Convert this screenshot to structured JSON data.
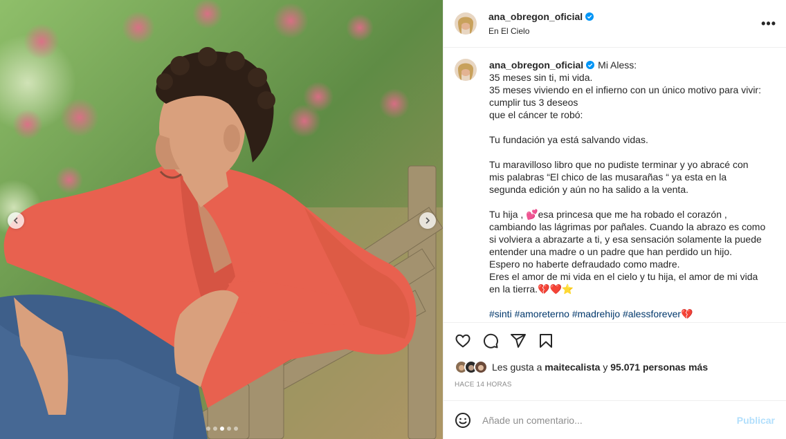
{
  "header": {
    "username": "ana_obregon_oficial",
    "location": "En El Cielo",
    "more_label": "•••"
  },
  "caption": {
    "username": "ana_obregon_oficial",
    "lines": [
      "Mi Aless:",
      "35 meses sin ti, mi vida.",
      "35 meses viviendo en el infierno con un único motivo para vivir: cumplir tus 3 deseos",
      "que el cáncer te robó:",
      "",
      "Tu fundación ya está salvando vidas.",
      "",
      "Tu maravilloso libro que no pudiste terminar y yo abracé con mis palabras “El chico de las musarañas “ ya esta en la segunda edición y aún no ha salido a la venta.",
      "",
      "Tu hija , 💕esa princesa que me ha robado el corazón , cambiando las lágrimas por pañales. Cuando la abrazo es como si volviera a abrazarte a ti, y esa sensación solamente la puede entender una madre o un padre que han perdido un hijo.",
      "Espero no haberte defraudado como madre.",
      "Eres el amor de mi vida en el cielo y tu hija, el amor de mi vida en la tierra.💔❤️⭐️",
      ""
    ],
    "hashtags": "#sinti #amoreterno #madrehijo #alessforever💔"
  },
  "likes": {
    "prefix": "Les gusta a ",
    "user": "maitecalista",
    "middle": " y ",
    "count": "95.071 personas más"
  },
  "time_ago": "HACE 14 HORAS",
  "comment_box": {
    "placeholder": "Añade un comentario...",
    "publish_label": "Publicar"
  },
  "carousel": {
    "total": 5,
    "active_index": 2
  },
  "colors": {
    "verified": "#0095f6",
    "shirt": "#e8614f",
    "hashtag": "#00376b",
    "publish": "#b2dffc"
  }
}
